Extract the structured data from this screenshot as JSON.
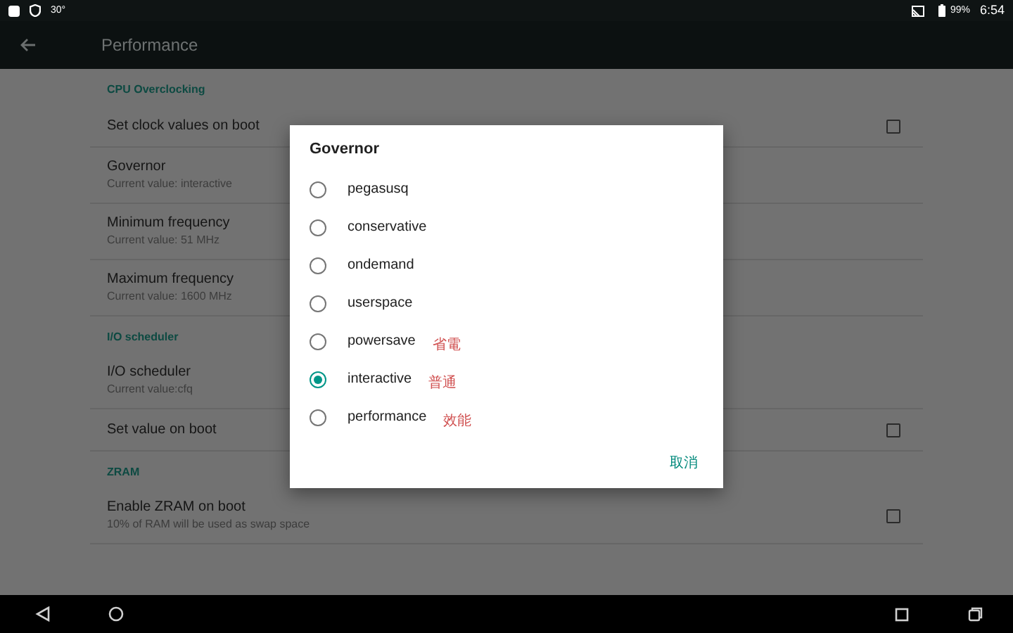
{
  "status_bar": {
    "left_text": "30°",
    "battery": "99%",
    "time": "6:54"
  },
  "app_bar": {
    "title": "Performance"
  },
  "sections": [
    {
      "header": "CPU Overclocking",
      "items": [
        {
          "kind": "checkbox",
          "title": "Set clock values on boot",
          "checked": false
        },
        {
          "kind": "plain",
          "title": "Governor",
          "summary": "Current value: interactive"
        },
        {
          "kind": "plain",
          "title": "Minimum frequency",
          "summary": "Current value: 51 MHz"
        },
        {
          "kind": "plain",
          "title": "Maximum frequency",
          "summary": "Current value: 1600 MHz"
        }
      ]
    },
    {
      "header": "I/O scheduler",
      "items": [
        {
          "kind": "plain",
          "title": "I/O scheduler",
          "summary": "Current value:cfq"
        },
        {
          "kind": "checkbox",
          "title": "Set value on boot",
          "checked": false
        }
      ]
    },
    {
      "header": "ZRAM",
      "items": [
        {
          "kind": "checkbox",
          "title": "Enable ZRAM on boot",
          "summary": "10% of RAM will be used as swap space",
          "checked": false
        }
      ]
    }
  ],
  "dialog": {
    "title": "Governor",
    "options": [
      {
        "label": "pegasusq",
        "selected": false
      },
      {
        "label": "conservative",
        "selected": false
      },
      {
        "label": "ondemand",
        "selected": false
      },
      {
        "label": "userspace",
        "selected": false
      },
      {
        "label": "powersave",
        "selected": false,
        "note": "省電"
      },
      {
        "label": "interactive",
        "selected": true,
        "note": "普通"
      },
      {
        "label": "performance",
        "selected": false,
        "note": "效能"
      }
    ],
    "cancel": "取消"
  }
}
